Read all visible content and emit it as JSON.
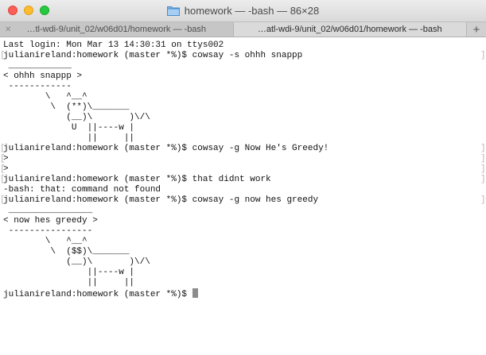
{
  "window": {
    "title": "homework — -bash — 86×28",
    "title_icon": "folder-icon"
  },
  "tabs": [
    {
      "label": "…tl-wdi-9/unit_02/w06d01/homework — -bash",
      "active": false
    },
    {
      "label": "…atl-wdi-9/unit_02/w06d01/homework — -bash",
      "active": true
    }
  ],
  "tab_add_label": "+",
  "colors": {
    "close": "#fc5f57",
    "minimize": "#fdbc2e",
    "maximize": "#28c840",
    "terminal_bg": "#ffffff",
    "terminal_fg": "#111111",
    "cursor": "#8c8c8c"
  },
  "terminal": {
    "lines": [
      {
        "text": "Last login: Mon Mar 13 14:30:31 on ttys002",
        "mark": false
      },
      {
        "text": "julianireland:homework (master *%)$ cowsay -s ohhh snappp",
        "mark": true
      },
      {
        "text": " ____________",
        "mark": false
      },
      {
        "text": "< ohhh snappp >",
        "mark": false
      },
      {
        "text": " ------------",
        "mark": false
      },
      {
        "text": "        \\   ^__^",
        "mark": false
      },
      {
        "text": "         \\  (**)\\_______",
        "mark": false
      },
      {
        "text": "            (__)\\       )\\/\\",
        "mark": false
      },
      {
        "text": "             U  ||----w |",
        "mark": false
      },
      {
        "text": "                ||     ||",
        "mark": false
      },
      {
        "text": "julianireland:homework (master *%)$ cowsay -g Now He's Greedy!",
        "mark": true
      },
      {
        "text": ">",
        "mark": true
      },
      {
        "text": ">",
        "mark": true
      },
      {
        "text": "julianireland:homework (master *%)$ that didnt work",
        "mark": true
      },
      {
        "text": "-bash: that: command not found",
        "mark": false
      },
      {
        "text": "julianireland:homework (master *%)$ cowsay -g now hes greedy",
        "mark": true
      },
      {
        "text": " ________________",
        "mark": false
      },
      {
        "text": "< now hes greedy >",
        "mark": false
      },
      {
        "text": " ----------------",
        "mark": false
      },
      {
        "text": "        \\   ^__^",
        "mark": false
      },
      {
        "text": "         \\  ($$)\\_______",
        "mark": false
      },
      {
        "text": "            (__)\\       )\\/\\",
        "mark": false
      },
      {
        "text": "                ||----w |",
        "mark": false
      },
      {
        "text": "                ||     ||",
        "mark": false
      },
      {
        "text": "julianireland:homework (master *%)$ ",
        "mark": false,
        "cursor": true
      }
    ]
  }
}
